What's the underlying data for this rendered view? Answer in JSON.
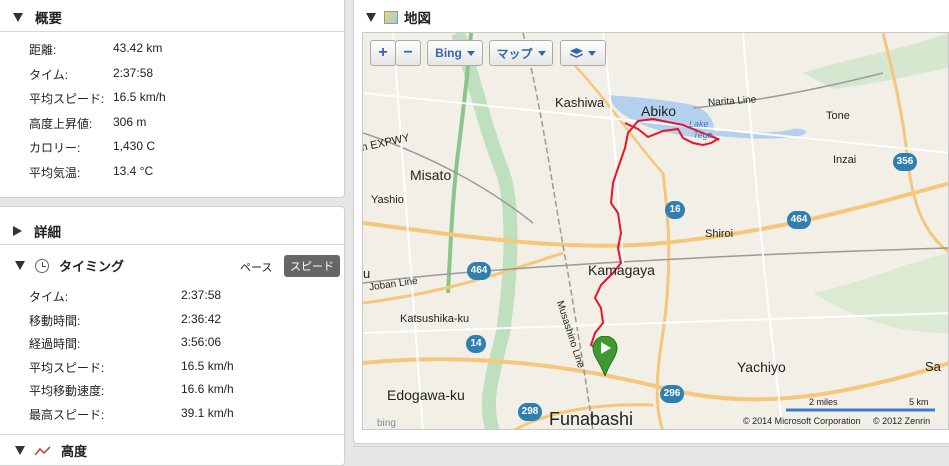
{
  "summary": {
    "title": "概要",
    "rows": [
      {
        "k": "距離:",
        "v": "43.42 km"
      },
      {
        "k": "タイム:",
        "v": "2:37:58"
      },
      {
        "k": "平均スピード:",
        "v": "16.5 km/h"
      },
      {
        "k": "高度上昇値:",
        "v": "306 m"
      },
      {
        "k": "カロリー:",
        "v": "1,430 C"
      },
      {
        "k": "平均気温:",
        "v": "13.4 °C"
      }
    ]
  },
  "details": {
    "title": "詳細",
    "timing": {
      "title": "タイミング",
      "pace_label": "ペース",
      "speed_label": "スピード",
      "rows": [
        {
          "k": "タイム:",
          "v": "2:37:58"
        },
        {
          "k": "移動時間:",
          "v": "2:36:42"
        },
        {
          "k": "経過時間:",
          "v": "3:56:06"
        },
        {
          "k": "平均スピード:",
          "v": "16.5 km/h"
        },
        {
          "k": "平均移動速度:",
          "v": "16.6 km/h"
        },
        {
          "k": "最高スピード:",
          "v": "39.1 km/h"
        }
      ]
    },
    "elevation_title": "高度"
  },
  "map": {
    "title": "地図",
    "zoom_in": "+",
    "zoom_out": "−",
    "provider": "Bing",
    "map_type": "マップ",
    "labels": {
      "kashiwa": "Kashiwa",
      "abiko": "Abiko",
      "narita_line": "Narita Line",
      "tone": "Tone",
      "lake": "Lake",
      "teganuma": "Tega",
      "inzai": "Inzai",
      "expwy": "n EXPWY",
      "misato": "Misato",
      "yashio": "Yashio",
      "shiroi": "Shiroi",
      "kamagaya": "Kamagaya",
      "u": "u",
      "joban": "Joban Line",
      "katsushika": "Katsushika-ku",
      "musashino": "Musashino Line",
      "yachiyo": "Yachiyo",
      "edogawa": "Edogawa-ku",
      "funabashi": "Funabashi",
      "sa": "Sa"
    },
    "shields": {
      "s356": "356",
      "s16": "16",
      "s464a": "464",
      "s464b": "464",
      "s14": "14",
      "s296": "296",
      "s298": "298"
    },
    "scale_miles": "2 miles",
    "scale_km": "5 km",
    "copyright_ms": "© 2014 Microsoft Corporation",
    "copyright_zenrin": "© 2012 Zenrin",
    "bing_logo": "bing"
  }
}
